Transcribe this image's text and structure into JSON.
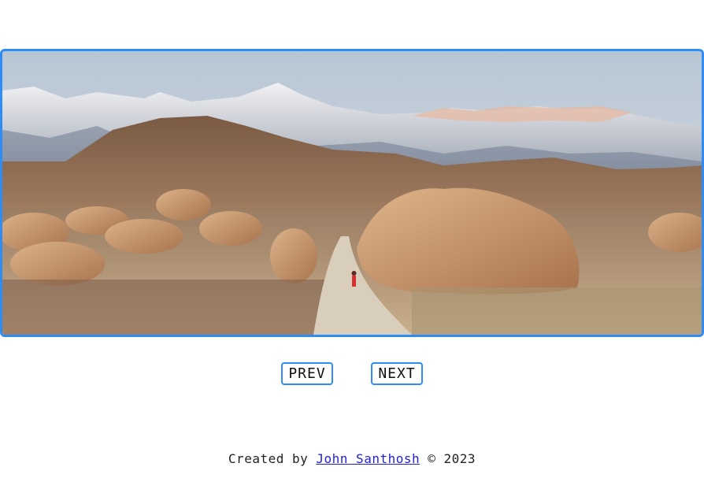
{
  "slider": {
    "image_alt": "Desert rock formations with snowy mountains and a person on a dirt road",
    "accent_color": "#2f8cf5"
  },
  "controls": {
    "prev_label": "PREV",
    "next_label": "NEXT"
  },
  "footer": {
    "prefix": "Created by ",
    "author": "John Santhosh",
    "suffix": " © 2023"
  }
}
